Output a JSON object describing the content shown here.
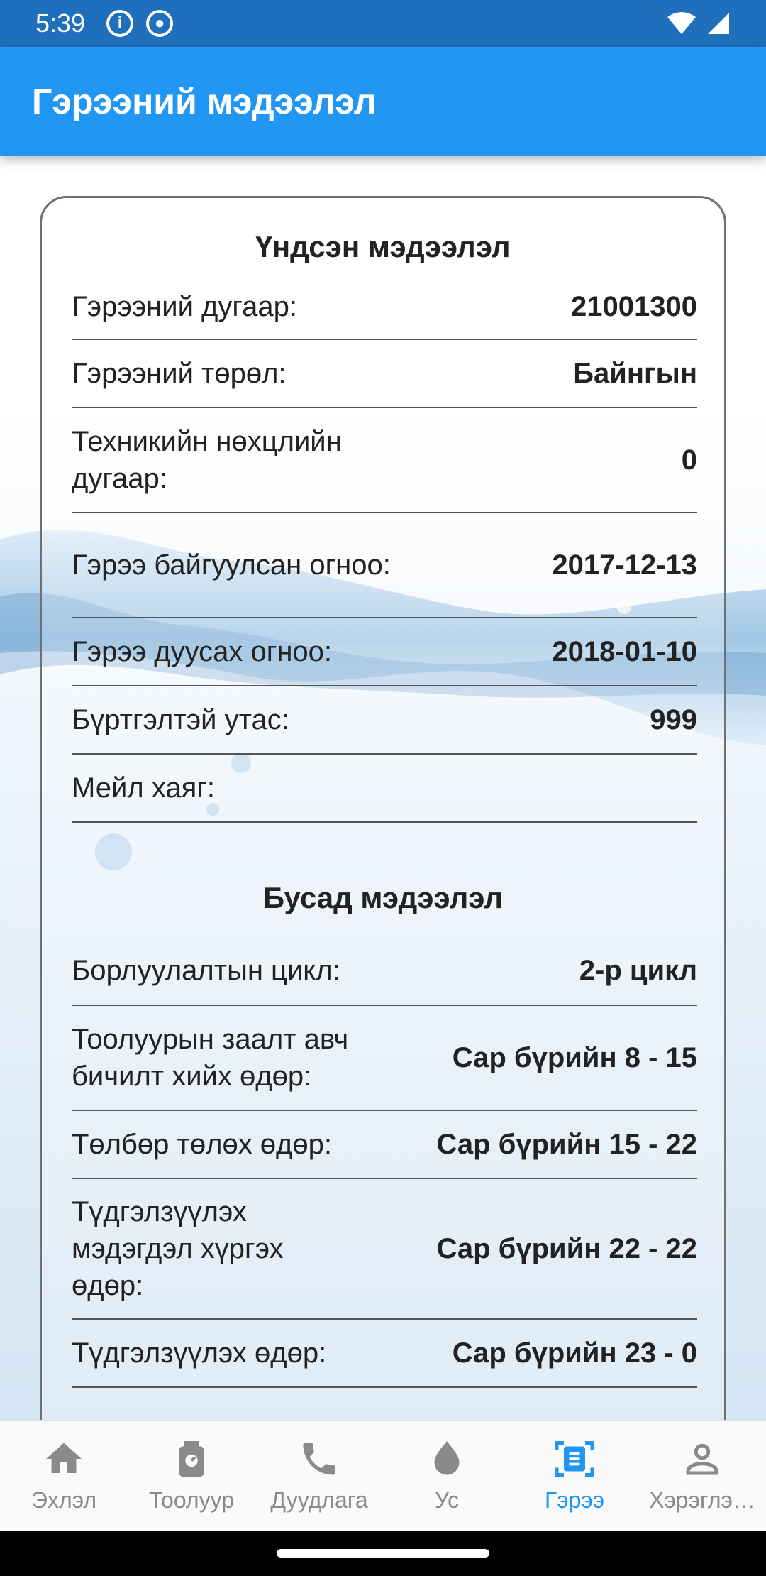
{
  "status_bar": {
    "time": "5:39"
  },
  "app_bar": {
    "title": "Гэрээний мэдээлэл"
  },
  "main_info": {
    "title": "Үндсэн мэдээлэл",
    "rows": [
      {
        "label": "Гэрээний дугаар:",
        "value": "21001300"
      },
      {
        "label": "Гэрээний төрөл:",
        "value": "Байнгын"
      },
      {
        "label": "Техникийн нөхцлийн дугаар:",
        "value": "0"
      },
      {
        "label": "Гэрээ байгуулсан огноо:",
        "value": "2017-12-13"
      },
      {
        "label": "Гэрээ дуусах огноо:",
        "value": "2018-01-10"
      },
      {
        "label": "Бүртгэлтэй утас:",
        "value": "999"
      },
      {
        "label": "Мейл хаяг:",
        "value": ""
      }
    ]
  },
  "other_info": {
    "title": "Бусад мэдээлэл",
    "rows": [
      {
        "label": "Борлуулалтын цикл:",
        "value": "2-р цикл"
      },
      {
        "label": "Тоолуурын заалт авч бичилт хийх өдөр:",
        "value": "Сар бүрийн 8 - 15"
      },
      {
        "label": "Төлбөр төлөх өдөр:",
        "value": "Сар бүрийн 15 - 22"
      },
      {
        "label": "Түдгэлзүүлэх мэдэгдэл хүргэх өдөр:",
        "value": "Сар бүрийн 22 - 22"
      },
      {
        "label": "Түдгэлзүүлэх өдөр:",
        "value": "Сар бүрийн 23 - 0"
      }
    ]
  },
  "bottom_nav": {
    "items": [
      {
        "label": "Эхлэл",
        "icon": "home-icon"
      },
      {
        "label": "Тоолуур",
        "icon": "meter-icon"
      },
      {
        "label": "Дуудлага",
        "icon": "phone-icon"
      },
      {
        "label": "Ус",
        "icon": "water-drop-icon"
      },
      {
        "label": "Гэрээ",
        "icon": "contract-icon",
        "active": true
      },
      {
        "label": "Хэрэглэ…",
        "icon": "user-icon"
      }
    ]
  },
  "colors": {
    "primary": "#2196f3",
    "status_bar": "#1f6fbd",
    "inactive": "#8a8a8a"
  }
}
